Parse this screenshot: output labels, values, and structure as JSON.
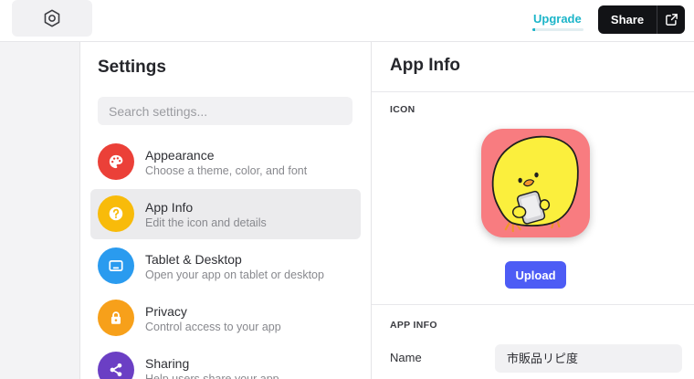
{
  "topbar": {
    "logo_icon": "hexagon-icon",
    "upgrade": {
      "label": "Upgrade",
      "progress": 0.06,
      "color": "#1cb5c9"
    },
    "share": {
      "label": "Share",
      "icon": "external-link-icon"
    }
  },
  "settings": {
    "title": "Settings",
    "search": {
      "placeholder": "Search settings...",
      "icon": "none"
    },
    "items": [
      {
        "label": "Appearance",
        "description": "Choose a theme, color, and font",
        "icon": "palette-icon",
        "color": "#eb4038",
        "selected": false
      },
      {
        "label": "App Info",
        "description": "Edit the icon and details",
        "icon": "question-icon",
        "color": "#f8bb0a",
        "selected": true
      },
      {
        "label": "Tablet & Desktop",
        "description": "Open your app on tablet or desktop",
        "icon": "tablet-icon",
        "color": "#2a9bef",
        "selected": false
      },
      {
        "label": "Privacy",
        "description": "Control access to your app",
        "icon": "lock-icon",
        "color": "#f7a01a",
        "selected": false
      },
      {
        "label": "Sharing",
        "description": "Help users share your app",
        "icon": "share-icon",
        "color": "#6b3fc4",
        "selected": false
      }
    ]
  },
  "app_info": {
    "title": "App Info",
    "icon_section": {
      "label": "ICON",
      "icon": "chick-app-icon",
      "background": "#f87c80",
      "upload_label": "Upload",
      "upload_color": "#4d5cf5"
    },
    "details_section": {
      "label": "APP INFO",
      "name": {
        "label": "Name",
        "value": "市販品リピ度"
      }
    }
  }
}
